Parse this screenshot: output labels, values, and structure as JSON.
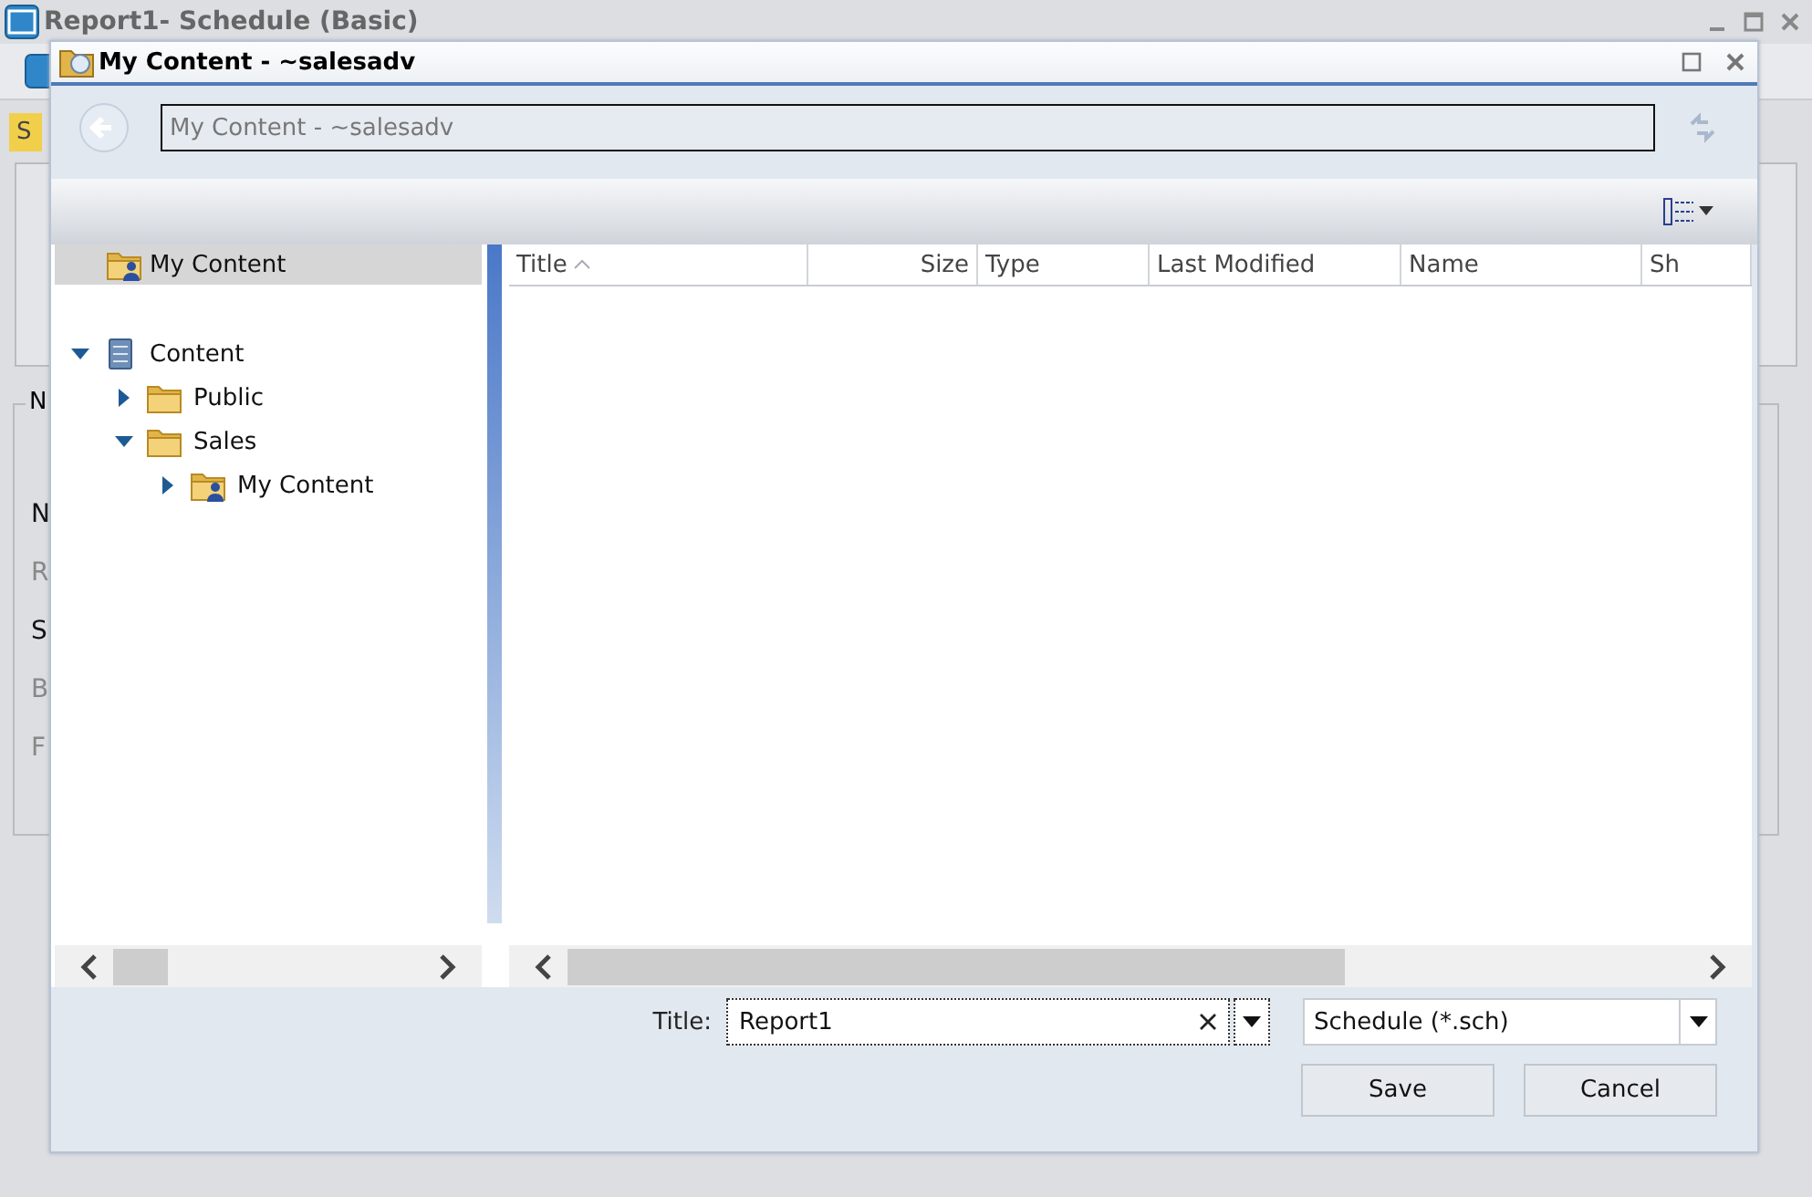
{
  "background_window": {
    "title": "Report1- Schedule (Basic)",
    "tab": {
      "label": "S",
      "selected": true
    },
    "group_label": "N",
    "field_labels": [
      {
        "label": "N",
        "disabled": false
      },
      {
        "label": "R",
        "disabled": true
      },
      {
        "label": "S",
        "disabled": false
      },
      {
        "label": "B",
        "disabled": true
      },
      {
        "label": "F",
        "disabled": true
      }
    ]
  },
  "dialog": {
    "title": "My Content - ~salesadv",
    "address": "My Content - ~salesadv",
    "tree": {
      "root": {
        "label": "My Content",
        "selected": true
      },
      "items": [
        {
          "label": "Content",
          "kind": "server",
          "expanded": true,
          "children": [
            {
              "label": "Public",
              "kind": "folder",
              "expanded": false
            },
            {
              "label": "Sales",
              "kind": "folder",
              "expanded": true,
              "children": [
                {
                  "label": "My Content",
                  "kind": "user-folder",
                  "expanded": false
                }
              ]
            }
          ]
        }
      ]
    },
    "columns": [
      {
        "label": "Title",
        "kind": "text",
        "sorted": true
      },
      {
        "label": "Size",
        "kind": "number",
        "sorted": false
      },
      {
        "label": "Type",
        "kind": "text",
        "sorted": false
      },
      {
        "label": "Last Modified",
        "kind": "text",
        "sorted": false
      },
      {
        "label": "Name",
        "kind": "text",
        "sorted": false
      },
      {
        "label": "Sh",
        "kind": "text",
        "sorted": false
      }
    ],
    "title_label": "Title:",
    "title_value": "Report1",
    "file_type": "Schedule (*.sch)",
    "buttons": [
      "Save",
      "Cancel"
    ]
  }
}
